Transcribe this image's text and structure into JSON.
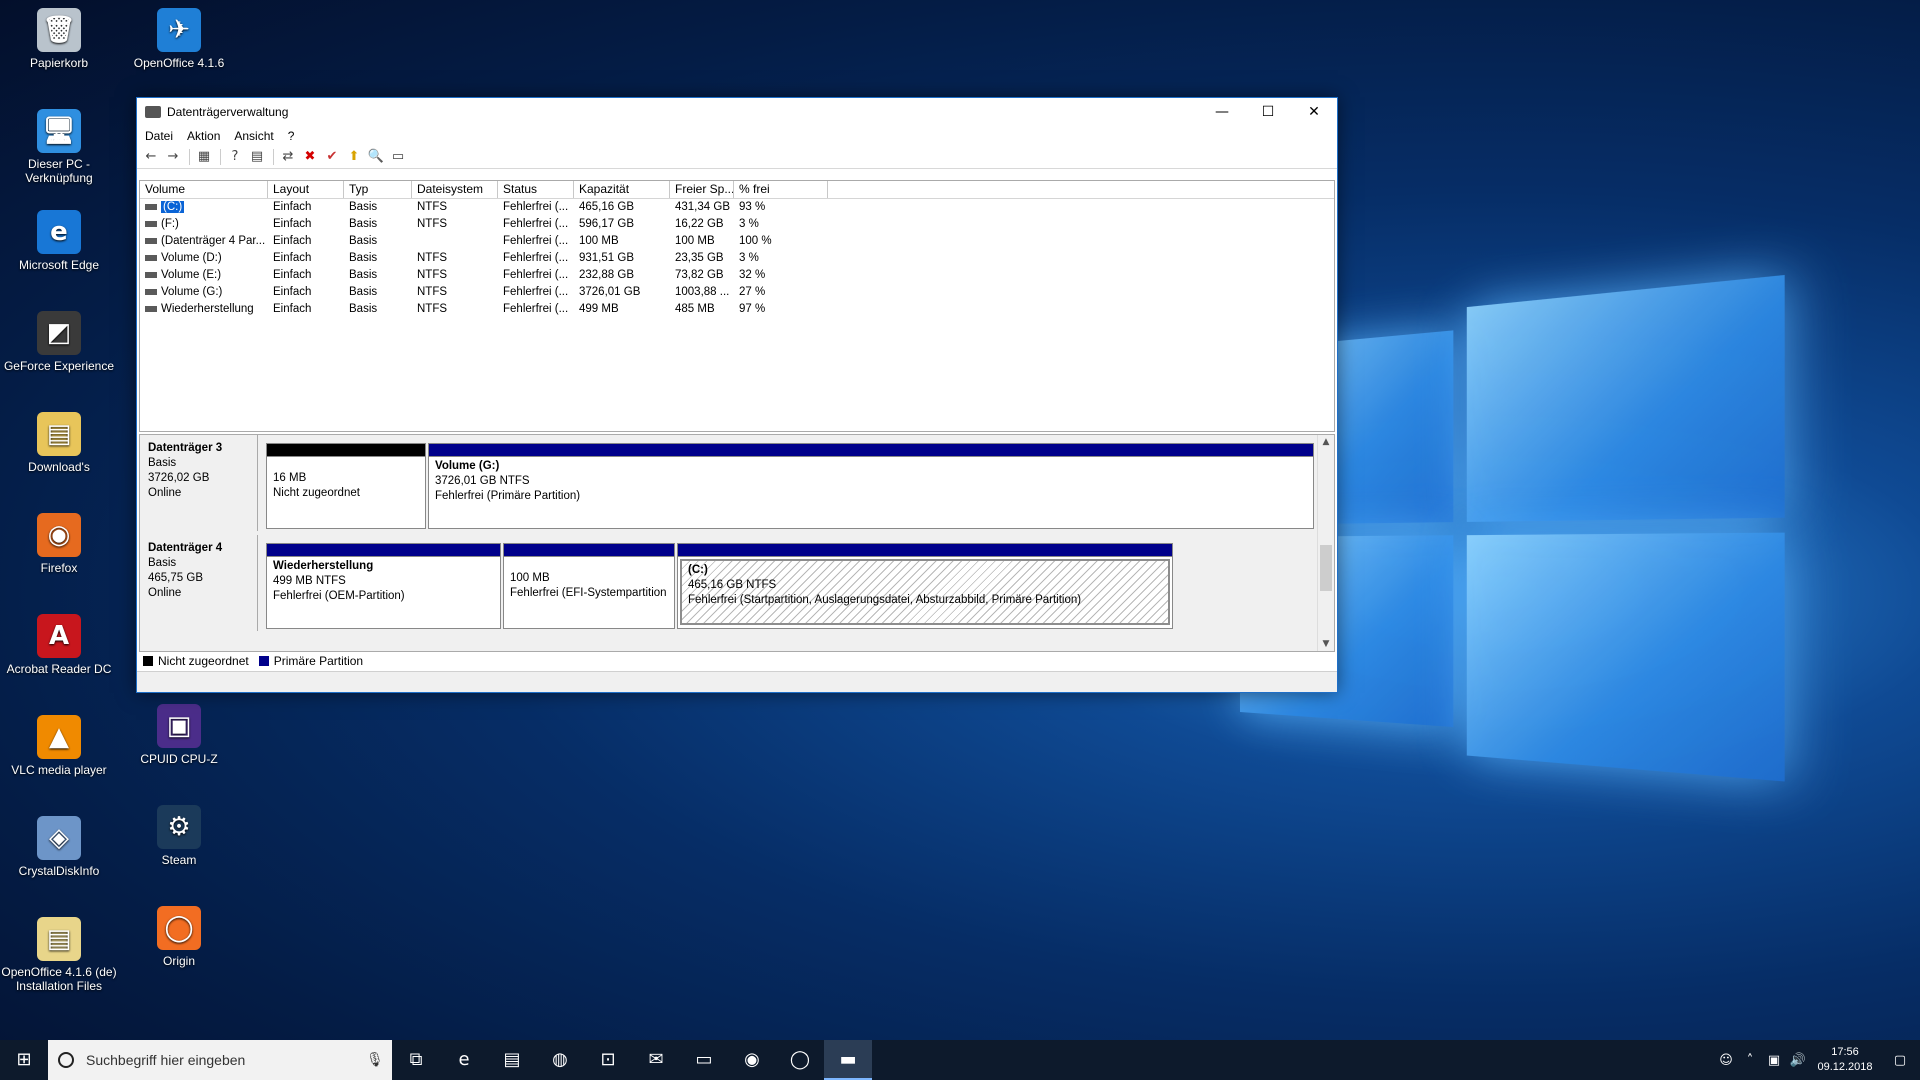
{
  "desktop": {
    "icons_col1": [
      {
        "label": "Papierkorb",
        "icon": "recycle-bin-icon",
        "color": "#b9c3cc",
        "glyph": "🗑"
      },
      {
        "label": "Dieser PC - Verknüpfung",
        "icon": "this-pc-icon",
        "color": "#2f8fe0",
        "glyph": "🖥"
      },
      {
        "label": "Microsoft Edge",
        "icon": "edge-icon",
        "color": "#1877d6",
        "glyph": "e"
      },
      {
        "label": "GeForce Experience",
        "icon": "geforce-icon",
        "color": "#3a3a3a",
        "glyph": "◩"
      },
      {
        "label": "Download's",
        "icon": "folder-icon",
        "color": "#e8c55a",
        "glyph": "▤"
      },
      {
        "label": "Firefox",
        "icon": "firefox-icon",
        "color": "#e66a1f",
        "glyph": "◉"
      },
      {
        "label": "Acrobat Reader DC",
        "icon": "acrobat-icon",
        "color": "#c8161d",
        "glyph": "A"
      },
      {
        "label": "VLC media player",
        "icon": "vlc-icon",
        "color": "#f08a00",
        "glyph": "▲"
      },
      {
        "label": "CrystalDiskInfo",
        "icon": "crystaldiskinfo-icon",
        "color": "#6d95c8",
        "glyph": "◈"
      },
      {
        "label": "OpenOffice 4.1.6 (de) Installation Files",
        "icon": "folder-icon",
        "color": "#e8d58a",
        "glyph": "▤"
      }
    ],
    "icons_col2": [
      {
        "label": "OpenOffice 4.1.6",
        "icon": "openoffice-icon",
        "color": "#1f7fd6",
        "glyph": "✈"
      },
      {
        "label": "CPUID CPU-Z",
        "icon": "cpuz-icon",
        "color": "#4b2d8a",
        "glyph": "▣"
      },
      {
        "label": "Steam",
        "icon": "steam-icon",
        "color": "#1b3a5a",
        "glyph": "⚙"
      },
      {
        "label": "Origin",
        "icon": "origin-icon",
        "color": "#f26d22",
        "glyph": "◯"
      }
    ]
  },
  "window": {
    "title": "Datenträgerverwaltung",
    "minimize": "—",
    "maximize": "☐",
    "close": "✕",
    "menu": [
      "Datei",
      "Aktion",
      "Ansicht",
      "?"
    ],
    "toolbar": [
      "←",
      "→",
      "▦",
      "?",
      "▤",
      "⇄",
      "✖",
      "✔",
      "⬆",
      "🔍",
      "▭"
    ],
    "columns": [
      "Volume",
      "Layout",
      "Typ",
      "Dateisystem",
      "Status",
      "Kapazität",
      "Freier Sp...",
      "% frei"
    ],
    "rows": [
      {
        "volume": "(C:)",
        "layout": "Einfach",
        "typ": "Basis",
        "fs": "NTFS",
        "status": "Fehlerfrei (...",
        "kap": "465,16 GB",
        "frei": "431,34 GB",
        "pct": "93 %",
        "selected": true
      },
      {
        "volume": "(F:)",
        "layout": "Einfach",
        "typ": "Basis",
        "fs": "NTFS",
        "status": "Fehlerfrei (...",
        "kap": "596,17 GB",
        "frei": "16,22 GB",
        "pct": "3 %"
      },
      {
        "volume": "(Datenträger 4 Par...",
        "layout": "Einfach",
        "typ": "Basis",
        "fs": "",
        "status": "Fehlerfrei (...",
        "kap": "100 MB",
        "frei": "100 MB",
        "pct": "100 %"
      },
      {
        "volume": "Volume (D:)",
        "layout": "Einfach",
        "typ": "Basis",
        "fs": "NTFS",
        "status": "Fehlerfrei (...",
        "kap": "931,51 GB",
        "frei": "23,35 GB",
        "pct": "3 %"
      },
      {
        "volume": "Volume (E:)",
        "layout": "Einfach",
        "typ": "Basis",
        "fs": "NTFS",
        "status": "Fehlerfrei (...",
        "kap": "232,88 GB",
        "frei": "73,82 GB",
        "pct": "32 %"
      },
      {
        "volume": "Volume (G:)",
        "layout": "Einfach",
        "typ": "Basis",
        "fs": "NTFS",
        "status": "Fehlerfrei (...",
        "kap": "3726,01 GB",
        "frei": "1003,88 ...",
        "pct": "27 %"
      },
      {
        "volume": "Wiederherstellung",
        "layout": "Einfach",
        "typ": "Basis",
        "fs": "NTFS",
        "status": "Fehlerfrei (...",
        "kap": "499 MB",
        "frei": "485 MB",
        "pct": "97 %"
      }
    ],
    "disk3": {
      "name": "Datenträger 3",
      "type": "Basis",
      "size": "3726,02 GB",
      "state": "Online",
      "p1": {
        "line1": "16 MB",
        "line2": "Nicht zugeordnet"
      },
      "p2": {
        "title": "Volume  (G:)",
        "line1": "3726,01 GB NTFS",
        "line2": "Fehlerfrei (Primäre Partition)"
      }
    },
    "disk4": {
      "name": "Datenträger 4",
      "type": "Basis",
      "size": "465,75 GB",
      "state": "Online",
      "p1": {
        "title": "Wiederherstellung",
        "line1": "499 MB NTFS",
        "line2": "Fehlerfrei (OEM-Partition)"
      },
      "p2": {
        "line1": "100 MB",
        "line2": "Fehlerfrei (EFI-Systempartition"
      },
      "p3": {
        "title": "(C:)",
        "line1": "465,16 GB NTFS",
        "line2": "Fehlerfrei (Startpartition, Auslagerungsdatei, Absturzabbild, Primäre Partition)"
      }
    },
    "legend": {
      "unallocated": "Nicht zugeordnet",
      "primary": "Primäre Partition"
    },
    "colors": {
      "unallocated": "#000000",
      "primary": "#00008b",
      "selection": "#0a64d6"
    }
  },
  "taskbar": {
    "start_glyph": "⊞",
    "search_placeholder": "Suchbegriff hier eingeben",
    "mic_glyph": "🎙",
    "apps": [
      {
        "icon": "task-view-icon",
        "glyph": "⧉"
      },
      {
        "icon": "edge-icon",
        "glyph": "e"
      },
      {
        "icon": "file-explorer-icon",
        "glyph": "▤"
      },
      {
        "icon": "app-red-icon",
        "glyph": "◍"
      },
      {
        "icon": "store-icon",
        "glyph": "⊡"
      },
      {
        "icon": "mail-icon",
        "glyph": "✉"
      },
      {
        "icon": "pc-icon",
        "glyph": "▭"
      },
      {
        "icon": "firefox-icon",
        "glyph": "◉"
      },
      {
        "icon": "origin-icon",
        "glyph": "◯"
      },
      {
        "icon": "disk-management-icon",
        "glyph": "▬",
        "active": true
      }
    ],
    "tray": [
      {
        "icon": "people-icon",
        "glyph": "☺"
      },
      {
        "icon": "chevron-up-icon",
        "glyph": "˄"
      },
      {
        "icon": "network-icon",
        "glyph": "▣"
      },
      {
        "icon": "volume-icon",
        "glyph": "🔊"
      }
    ],
    "time": "17:56",
    "date": "09.12.2018",
    "notification_glyph": "▢"
  }
}
